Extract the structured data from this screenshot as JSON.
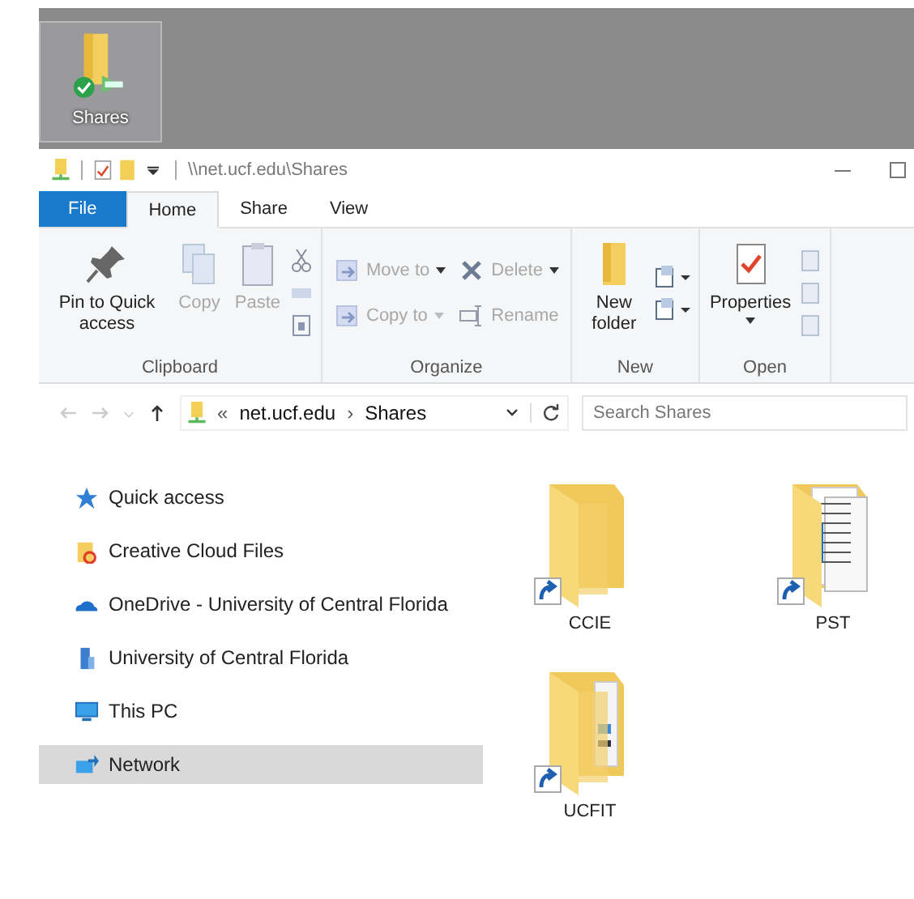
{
  "desktop_icon": {
    "label": "Shares",
    "selected": true
  },
  "window": {
    "title": "\\\\net.ucf.edu\\Shares"
  },
  "tabs": [
    {
      "label": "File",
      "kind": "file",
      "selected": false
    },
    {
      "label": "Home",
      "kind": "tab",
      "selected": true
    },
    {
      "label": "Share",
      "kind": "tab",
      "selected": false
    },
    {
      "label": "View",
      "kind": "tab",
      "selected": false
    }
  ],
  "ribbon": [
    {
      "label": "Clipboard",
      "columns": [
        [
          {
            "kind": "large",
            "label": "Pin to Quick access",
            "disabled": false
          }
        ],
        [
          {
            "kind": "large",
            "label": "Copy",
            "disabled": true
          }
        ],
        [
          {
            "kind": "large",
            "label": "Paste",
            "disabled": true
          }
        ],
        [
          {
            "kind": "icon"
          },
          {
            "kind": "icon"
          },
          {
            "kind": "icon"
          }
        ]
      ]
    },
    {
      "label": "Organize",
      "columns": [
        [
          {
            "kind": "small",
            "label": "Move to",
            "disabled": true,
            "dropdown": true
          },
          {
            "kind": "small",
            "label": "Copy to",
            "disabled": true,
            "dropdown": true
          }
        ],
        [
          {
            "kind": "small",
            "label": "Delete",
            "disabled": true,
            "dropdown": true
          },
          {
            "kind": "small",
            "label": "Rename",
            "disabled": true,
            "dropdown": false
          }
        ]
      ]
    },
    {
      "label": "New",
      "columns": [
        [
          {
            "kind": "large",
            "label": "New folder",
            "disabled": false
          }
        ],
        [
          {
            "kind": "icon",
            "dropdown": true
          },
          {
            "kind": "icon",
            "dropdown": true
          }
        ]
      ]
    },
    {
      "label": "Open",
      "columns": [
        [
          {
            "kind": "large",
            "label": "Properties",
            "disabled": false,
            "dropdown": true
          }
        ],
        [
          {
            "kind": "icon"
          },
          {
            "kind": "icon"
          },
          {
            "kind": "icon"
          }
        ]
      ]
    }
  ],
  "address": {
    "path": [
      {
        "label": "«",
        "kind": "overflow"
      },
      {
        "label": "net.ucf.edu",
        "kind": "crumb"
      },
      {
        "label": "›",
        "kind": "separator"
      },
      {
        "label": "Shares",
        "kind": "crumb"
      }
    ]
  },
  "search": {
    "placeholder": "Search Shares"
  },
  "sidebar": {
    "items": [
      {
        "label": "Quick access",
        "kind": "star",
        "selected": false
      },
      {
        "label": "Creative Cloud Files",
        "kind": "cloud-folder",
        "selected": false
      },
      {
        "label": "OneDrive - University of Central Florida",
        "kind": "onedrive",
        "selected": false
      },
      {
        "label": "University of Central Florida",
        "kind": "building",
        "selected": false
      },
      {
        "label": "This PC",
        "kind": "pc",
        "selected": false
      },
      {
        "label": "Network",
        "kind": "network",
        "selected": true
      }
    ]
  },
  "files": [
    {
      "name": "CCIE",
      "kind": "plain",
      "shortcut": true
    },
    {
      "name": "PST",
      "kind": "documents",
      "shortcut": true
    },
    {
      "name": "UCFIT",
      "kind": "mixed",
      "shortcut": true
    }
  ]
}
